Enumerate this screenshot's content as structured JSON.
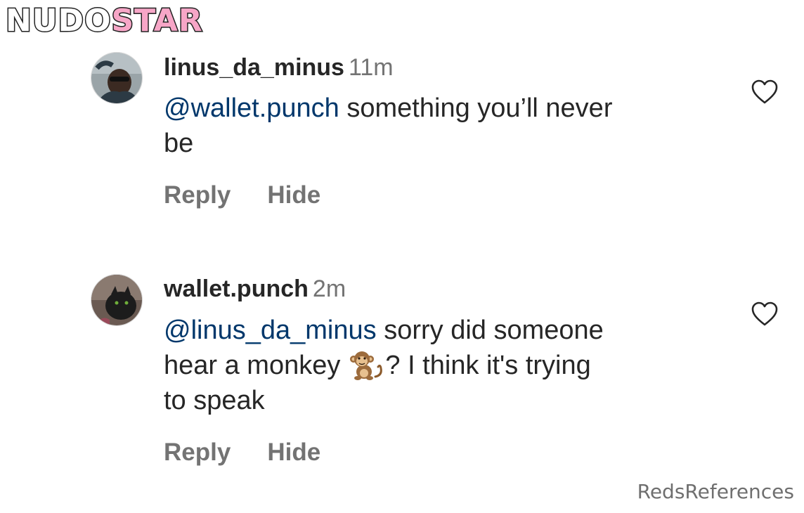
{
  "logo": {
    "part1": "NUDO",
    "part2": "STAR"
  },
  "comments": [
    {
      "username": "linus_da_minus",
      "time": "11m",
      "mention": "@wallet.punch",
      "text_line1": " something you’ll never",
      "text_line2": "be",
      "reply_label": "Reply",
      "hide_label": "Hide",
      "avatar_icon": "avatar-photo",
      "like_icon": "heart-outline-icon"
    },
    {
      "username": "wallet.punch",
      "time": "2m",
      "mention": "@linus_da_minus",
      "text_line1": " sorry did someone",
      "text_line2_a": "hear a monkey",
      "text_line2_b": "? I think it's trying",
      "text_line3": "to speak",
      "emoji": "monkey",
      "reply_label": "Reply",
      "hide_label": "Hide",
      "avatar_icon": "avatar-photo",
      "like_icon": "heart-outline-icon"
    }
  ],
  "watermark": "RedsReferences",
  "colors": {
    "mention": "#00376b",
    "secondary": "#737373",
    "text": "#262626",
    "logo_accent": "#f7a6c7"
  }
}
